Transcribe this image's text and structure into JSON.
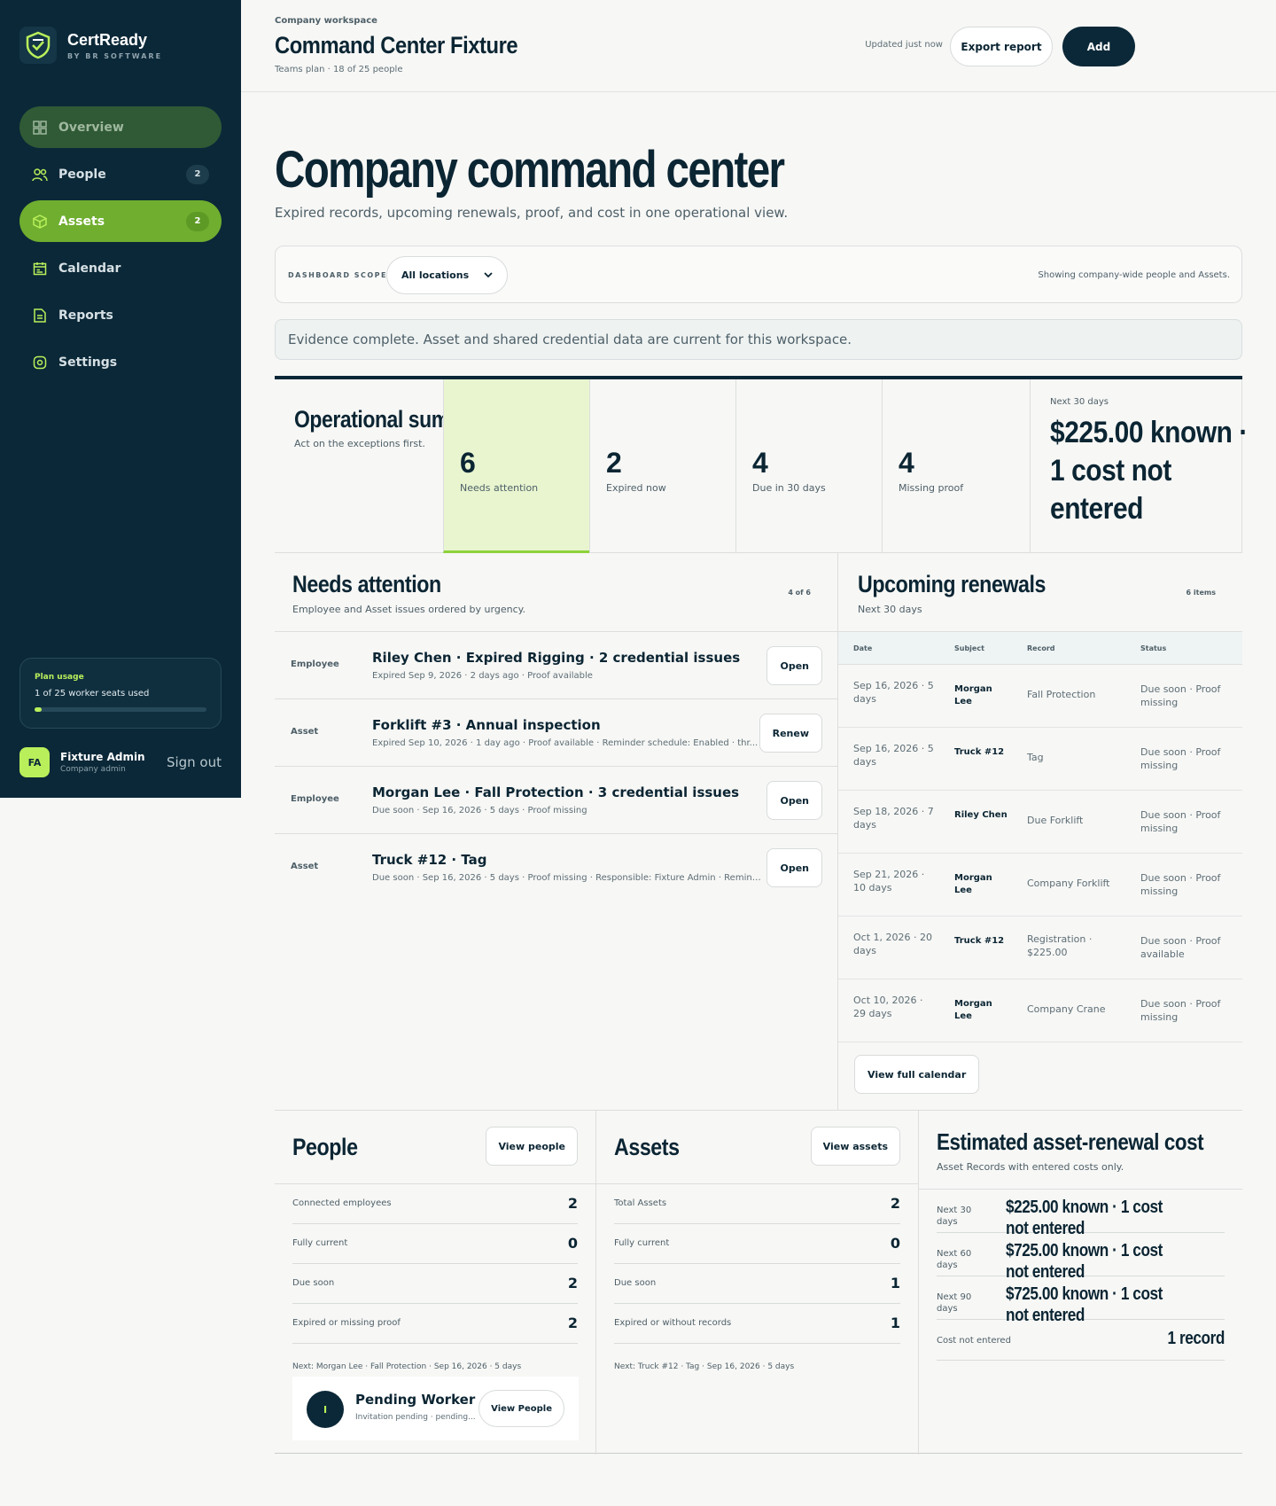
{
  "brand": {
    "name": "CertReady",
    "sub": "BY BR SOFTWARE"
  },
  "nav": {
    "overview": "Overview",
    "people": "People",
    "people_badge": "2",
    "assets": "Assets",
    "assets_badge": "2",
    "calendar": "Calendar",
    "reports": "Reports",
    "settings": "Settings"
  },
  "plan": {
    "title": "Plan usage",
    "text": "1 of 25 worker seats used",
    "fraction": 0.04
  },
  "user": {
    "initials": "FA",
    "name": "Fixture Admin",
    "role": "Company admin",
    "signout": "Sign out"
  },
  "header": {
    "label": "Company workspace",
    "title": "Command Center Fixture",
    "plan": "Teams plan · 18 of 25 people",
    "updated": "Updated just now",
    "export": "Export report",
    "add": "Add"
  },
  "main": {
    "title": "Company command center",
    "subtitle": "Expired records, upcoming renewals, proof, and cost in one operational view."
  },
  "scope": {
    "label": "DASHBOARD SCOPE",
    "selected": "All locations",
    "note": "Showing company-wide people and Assets."
  },
  "notice": "Evidence complete. Asset and shared credential data are current for this workspace.",
  "summary": {
    "title": "Operational summary",
    "note": "Act on the exceptions first.",
    "stats": [
      {
        "num": "6",
        "label": "Needs attention"
      },
      {
        "num": "2",
        "label": "Expired now"
      },
      {
        "num": "4",
        "label": "Due in 30 days"
      },
      {
        "num": "4",
        "label": "Missing proof"
      }
    ],
    "cost_label": "Next 30 days",
    "cost_value": "$225.00 known · 1 cost not entered"
  },
  "attention": {
    "title": "Needs attention",
    "subtitle": "Employee and Asset issues ordered by urgency.",
    "count": "4 of 6",
    "rows": [
      {
        "type": "Employee",
        "title": "Riley Chen · Expired Rigging · 2 credential issues",
        "meta": "Expired Sep 9, 2026 · 2 days ago · Proof available",
        "action": "Open"
      },
      {
        "type": "Asset",
        "title": "Forklift #3 · Annual inspection",
        "meta": "Expired Sep 10, 2026 · 1 day ago · Proof available · Reminder schedule: Enabled · thr...",
        "action": "Renew"
      },
      {
        "type": "Employee",
        "title": "Morgan Lee · Fall Protection · 3 credential issues",
        "meta": "Due soon · Sep 16, 2026 · 5 days · Proof missing",
        "action": "Open"
      },
      {
        "type": "Asset",
        "title": "Truck #12 · Tag",
        "meta": "Due soon · Sep 16, 2026 · 5 days · Proof missing · Responsible: Fixture Admin · Remind...",
        "action": "Open"
      }
    ]
  },
  "renewals": {
    "title": "Upcoming renewals",
    "subtitle": "Next 30 days",
    "count": "6 items",
    "headers": {
      "date": "Date",
      "subject": "Subject",
      "record": "Record",
      "status": "Status"
    },
    "rows": [
      {
        "date": "Sep 16, 2026 · 5 days",
        "subject": "Morgan Lee",
        "record": "Fall Protection",
        "status": "Due soon · Proof missing"
      },
      {
        "date": "Sep 16, 2026 · 5 days",
        "subject": "Truck #12",
        "record": "Tag",
        "status": "Due soon · Proof missing"
      },
      {
        "date": "Sep 18, 2026 · 7 days",
        "subject": "Riley Chen",
        "record": "Due Forklift",
        "status": "Due soon · Proof missing"
      },
      {
        "date": "Sep 21, 2026 · 10 days",
        "subject": "Morgan Lee",
        "record": "Company Forklift",
        "status": "Due soon · Proof missing"
      },
      {
        "date": "Oct 1, 2026 · 20 days",
        "subject": "Truck #12",
        "record": "Registration · $225.00",
        "status": "Due soon · Proof available"
      },
      {
        "date": "Oct 10, 2026 · 29 days",
        "subject": "Morgan Lee",
        "record": "Company Crane",
        "status": "Due soon · Proof missing"
      }
    ],
    "calendar_button": "View full calendar"
  },
  "people": {
    "title": "People",
    "button": "View people",
    "rows": [
      {
        "label": "Connected employees",
        "value": "2"
      },
      {
        "label": "Fully current",
        "value": "0"
      },
      {
        "label": "Due soon",
        "value": "2"
      },
      {
        "label": "Expired or missing proof",
        "value": "2"
      }
    ],
    "next": "Next: Morgan Lee · Fall Protection · Sep 16, 2026 · 5 days",
    "pending": {
      "initial": "I",
      "name": "Pending Worker",
      "meta": "Invitation pending · pending...",
      "button": "View People"
    }
  },
  "assets": {
    "title": "Assets",
    "button": "View assets",
    "rows": [
      {
        "label": "Total Assets",
        "value": "2"
      },
      {
        "label": "Fully current",
        "value": "0"
      },
      {
        "label": "Due soon",
        "value": "1"
      },
      {
        "label": "Expired or without records",
        "value": "1"
      }
    ],
    "next": "Next: Truck #12 · Tag · Sep 16, 2026 · 5 days"
  },
  "estimate": {
    "title": "Estimated asset-renewal cost",
    "subtitle": "Asset Records with entered costs only.",
    "rows": [
      {
        "label": "Next 30 days",
        "value": "$225.00 known · 1 cost not entered"
      },
      {
        "label": "Next 60 days",
        "value": "$725.00 known · 1 cost not entered"
      },
      {
        "label": "Next 90 days",
        "value": "$725.00 known · 1 cost not entered"
      }
    ],
    "last_label": "Cost not entered",
    "last_value": "1 record"
  },
  "colors": {
    "sidebar": "#0b2838",
    "accent": "#6fae2f",
    "highlight": "#e8f5cf",
    "lime": "#b9ef5a"
  }
}
